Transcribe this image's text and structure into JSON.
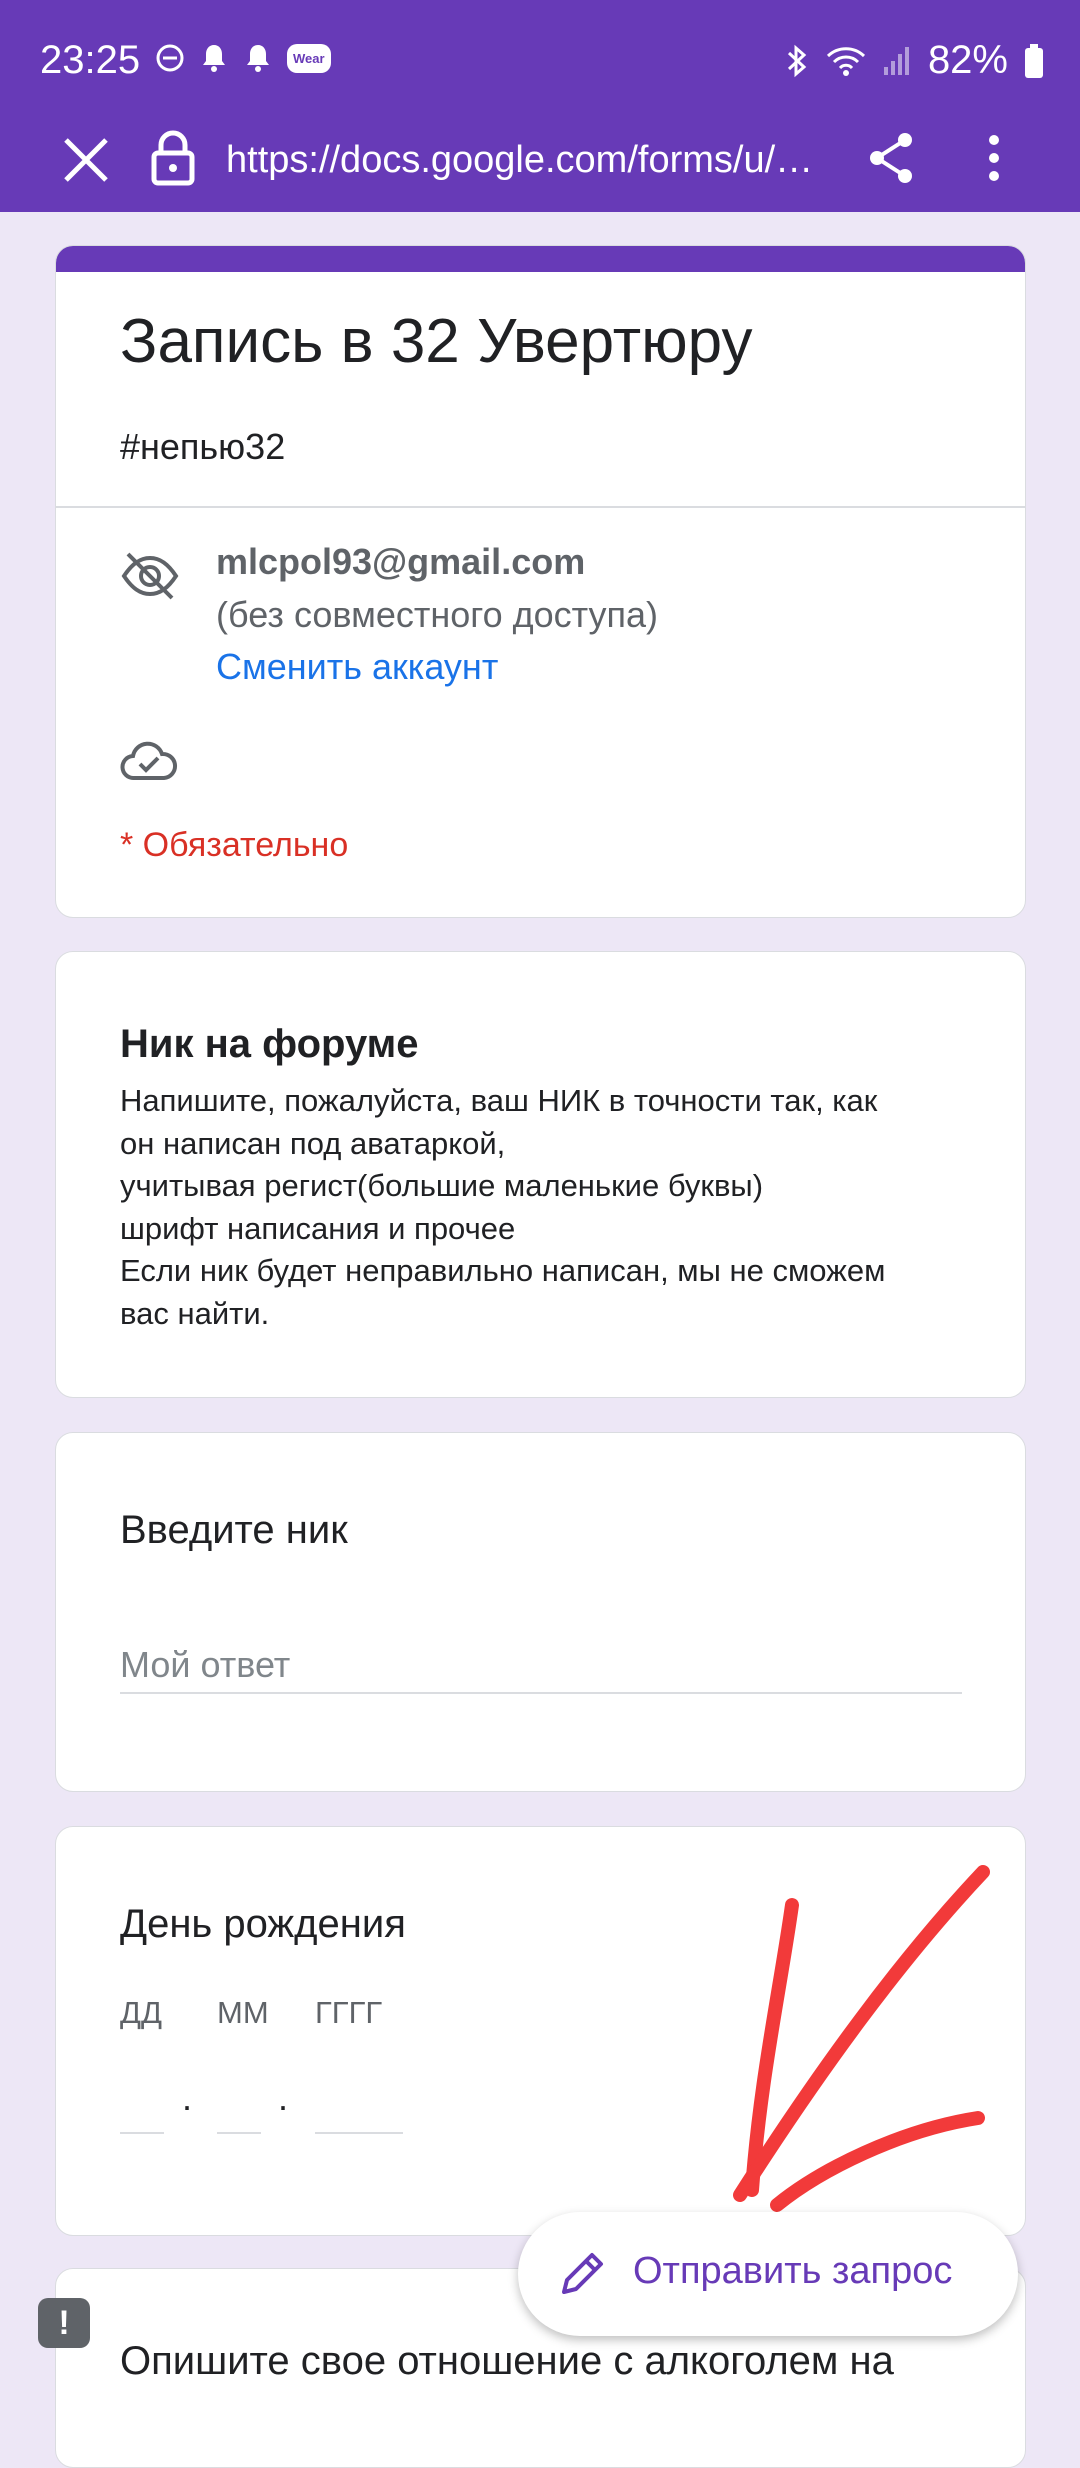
{
  "status_bar": {
    "time": "23:25",
    "battery": "82%",
    "wear_badge": "Wear"
  },
  "browser": {
    "url": "https://docs.google.com/forms/u/…"
  },
  "form": {
    "accent_color": "#673ab7",
    "title": "Запись в 32 Увертюру",
    "description": "#непью32",
    "account": {
      "email": "mlcpol93@gmail.com",
      "sharing_note": "(без совместного доступа)",
      "switch_link": "Сменить аккаунт"
    },
    "required_note": "* Обязательно",
    "sections": {
      "nick": {
        "title": "Ник на форуме",
        "description_lines": [
          "Напишите, пожалуйста, ваш НИК в точности так, как",
          "он написан под аватаркой,",
          "учитывая регист(большие маленькие буквы)",
          "шрифт написания и прочее",
          "Если ник будет неправильно написан,  мы не сможем",
          "вас найти."
        ]
      },
      "nick_input": {
        "title": "Введите ник",
        "placeholder": "Мой ответ"
      },
      "birthday": {
        "title": "День рождения",
        "day_label": "ДД",
        "month_label": "ММ",
        "year_label": "ГГГГ",
        "separator": "."
      },
      "alcohol": {
        "title": "Опишите свое отношение с алкоголем на"
      }
    },
    "submit_button": "Отправить запрос",
    "feedback_icon": "!"
  }
}
